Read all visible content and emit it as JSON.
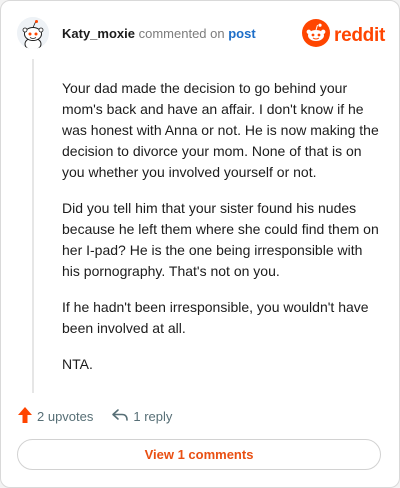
{
  "comment": {
    "username": "Katy_moxie",
    "action_text": "commented on",
    "target_link": "post",
    "brand": "reddit",
    "paragraphs": [
      "Your dad made the decision to go behind your mom's back and have an affair. I don't know if he was honest with Anna or not. He is now making the decision to divorce your mom. None of that is on you whether you involved yourself or not.",
      "Did you tell him that your sister found his nudes because he left them where she could find them on her I-pad? He is the one being irresponsible with his pornography. That's not on you.",
      "If he hadn't been irresponsible, you wouldn't have been involved at all.",
      "NTA."
    ]
  },
  "actions": {
    "upvotes_label": "2 upvotes",
    "reply_label": "1 reply"
  },
  "footer": {
    "view_comments_label": "View 1 comments"
  },
  "icons": {
    "avatar": "snoo-avatar-icon",
    "logo": "reddit-logo-icon",
    "upvote": "upvote-arrow-icon",
    "reply": "reply-arrow-icon"
  },
  "colors": {
    "brand": "#ff4500",
    "upvote": "#ff4500",
    "link": "#1d6ec8",
    "button_text": "#e94f12"
  }
}
